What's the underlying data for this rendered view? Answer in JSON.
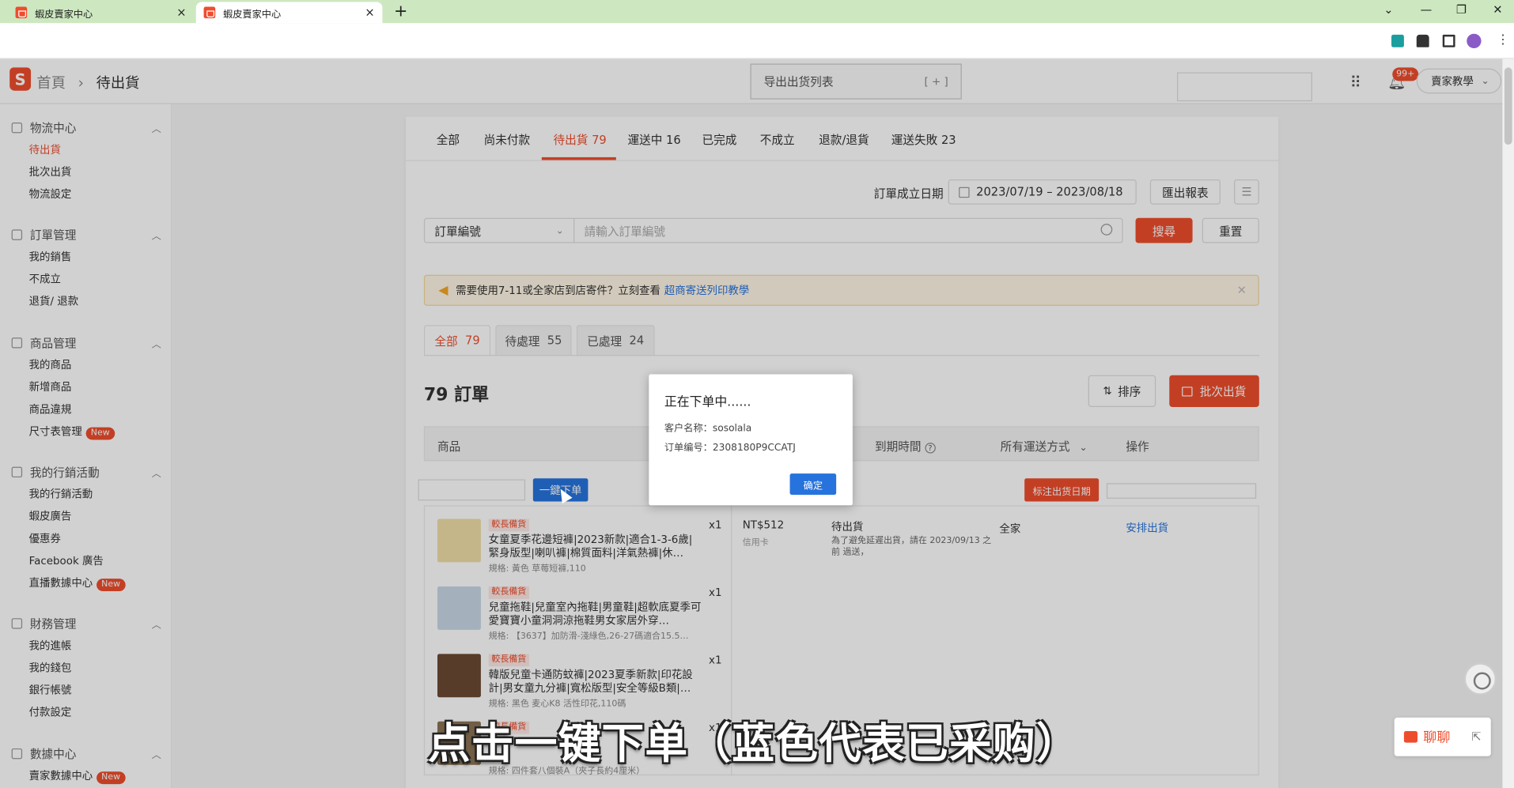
{
  "browser": {
    "tabs": [
      {
        "title": "蝦皮賣家中心"
      },
      {
        "title": "蝦皮賣家中心"
      }
    ],
    "new_tab": "+",
    "window_controls": [
      "⌄",
      "—",
      "❐",
      "✕"
    ],
    "close_glyph": "×"
  },
  "header": {
    "logo": "S",
    "breadcrumb": {
      "home": "首頁",
      "sep": "›",
      "current": "待出貨"
    },
    "export_list": {
      "label": "导出出货列表",
      "icon": "[ + ]"
    },
    "notifications_badge": "99+",
    "user_menu": "賣家教學"
  },
  "sidebar": {
    "sections": [
      {
        "title": "物流中心",
        "items": [
          {
            "label": "待出貨",
            "active": true
          },
          {
            "label": "批次出貨"
          },
          {
            "label": "物流設定"
          }
        ]
      },
      {
        "title": "訂單管理",
        "items": [
          {
            "label": "我的銷售"
          },
          {
            "label": "不成立"
          },
          {
            "label": "退貨/ 退款"
          }
        ]
      },
      {
        "title": "商品管理",
        "items": [
          {
            "label": "我的商品"
          },
          {
            "label": "新增商品"
          },
          {
            "label": "商品違規"
          },
          {
            "label": "尺寸表管理",
            "badge": "New"
          }
        ]
      },
      {
        "title": "我的行銷活動",
        "items": [
          {
            "label": "我的行銷活動"
          },
          {
            "label": "蝦皮廣告"
          },
          {
            "label": "優惠券"
          },
          {
            "label": "Facebook 廣告"
          },
          {
            "label": "直播數據中心",
            "badge": "New"
          }
        ]
      },
      {
        "title": "財務管理",
        "items": [
          {
            "label": "我的進帳"
          },
          {
            "label": "我的錢包"
          },
          {
            "label": "銀行帳號"
          },
          {
            "label": "付款設定"
          }
        ]
      },
      {
        "title": "數據中心",
        "items": [
          {
            "label": "賣家數據中心",
            "badge": "New"
          }
        ]
      }
    ]
  },
  "order_tabs": [
    {
      "label": "全部"
    },
    {
      "label": "尚未付款"
    },
    {
      "label": "待出貨 79",
      "active": true
    },
    {
      "label": "運送中 16"
    },
    {
      "label": "已完成"
    },
    {
      "label": "不成立"
    },
    {
      "label": "退款/退貨"
    },
    {
      "label": "運送失敗 23"
    }
  ],
  "filters": {
    "date_label": "訂單成立日期",
    "date_range": "2023/07/19 – 2023/08/18",
    "export_report": "匯出報表",
    "search_field": "訂單編號",
    "search_placeholder": "請輸入訂單編號",
    "search_button": "搜尋",
    "reset_button": "重置"
  },
  "notice": {
    "text": "需要使用7-11或全家店到店寄件？立刻查看",
    "link": "超商寄送列印教學",
    "close": "✕"
  },
  "sub_tabs": [
    {
      "label": "全部",
      "count": "79",
      "active": true
    },
    {
      "label": "待處理",
      "count": "55"
    },
    {
      "label": "已處理",
      "count": "24"
    }
  ],
  "orders": {
    "count_label": "79 訂單",
    "sort_button": "排序",
    "batch_ship_button": "批次出貨",
    "columns": [
      "商品",
      "到期時間",
      "所有運送方式",
      "操作"
    ],
    "one_key_order": "一鍵下单",
    "mark_ship_date": "标注出货日期",
    "row": {
      "products": [
        {
          "tag": "較長備貨",
          "name": "女童夏季花邊短褲|2023新款|適合1-3-6歲|緊身版型|喇叭褲|棉質面料|洋氣熱褲|休…",
          "spec": "規格: 黃色 草莓短褲,110",
          "qty": "x1",
          "color": "#f0dfa8"
        },
        {
          "tag": "較長備貨",
          "name": "兒童拖鞋|兒童室內拖鞋|男童鞋|超軟底夏季可愛寶寶小童洞洞涼拖鞋男女家居外穿…",
          "spec": "規格: 【3637】加防滑-淺綠色,26-27碼適合15.5…",
          "qty": "x1",
          "color": "#c9d8e6"
        },
        {
          "tag": "較長備貨",
          "name": "韓版兒童卡通防蚊褲|2023夏季新款|印花設計|男女童九分褲|寬松版型|安全等級B類|…",
          "spec": "規格: 黑色 麦心K8 活性印花,110碼",
          "qty": "x1",
          "color": "#6b4a34"
        },
        {
          "tag": "較長備貨",
          "name": "",
          "spec": "規格: 四件套八個裝A（夾子長約4厘米）",
          "qty": "x1",
          "color": "#8b7355"
        }
      ],
      "price": "NT$512",
      "payment": "信用卡",
      "status": "待出貨",
      "status_note": "為了避免延遲出貨，請在 2023/09/13 之前 過送，",
      "carrier": "全家",
      "action": "安排出貨"
    }
  },
  "modal": {
    "title": "正在下单中......",
    "customer": "客户名称：sosolala",
    "order_no": "订单编号：2308180P9CCATJ",
    "ok_button": "确定"
  },
  "subtitle": "点击一键下单（蓝色代表已采购）",
  "chat": {
    "label": "聊聊"
  },
  "colors": {
    "accent": "#ee4d2d",
    "primary_blue": "#2673dd"
  }
}
